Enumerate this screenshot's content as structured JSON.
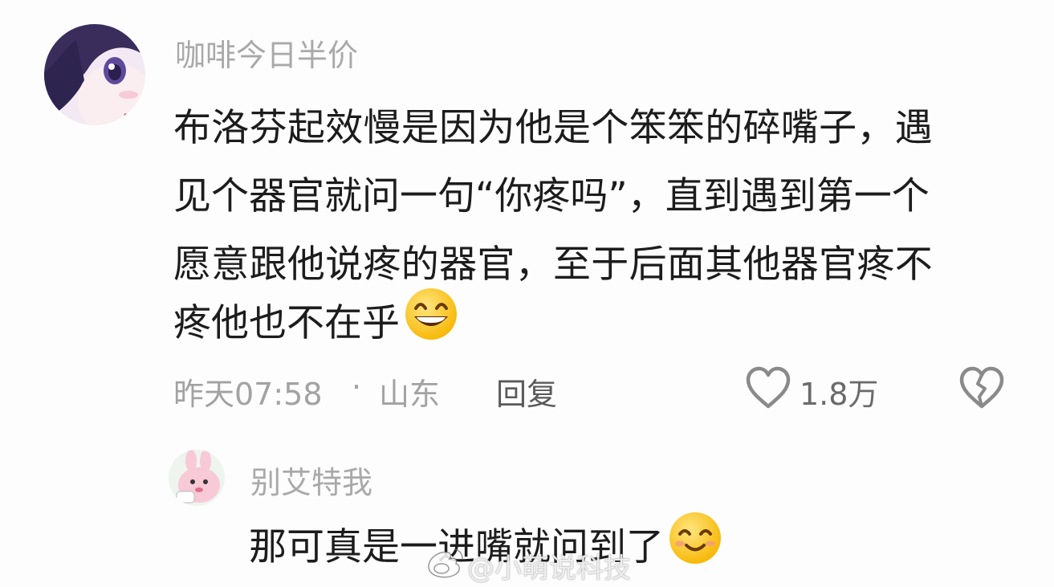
{
  "comment": {
    "username": "咖啡今日半价",
    "lines": [
      "布洛芬起效慢是因为他是个笨笨的碎嘴子，遇",
      "见个器官就问一句“你疼吗”，直到遇到第一个",
      "愿意跟他说疼的器官，至于后面其他器官疼不",
      "疼他也不在乎"
    ],
    "emoji": "grinning-face-emoji",
    "time": "昨天07:58",
    "separator": "·",
    "location": "山东",
    "reply_label": "回复",
    "like_count": "1.8万",
    "like_icon": "heart-outline-icon",
    "dislike_icon": "broken-heart-icon"
  },
  "reply": {
    "username": "别艾特我",
    "text": "那可真是一进嘴就问到了",
    "emoji": "smiling-face-emoji"
  },
  "watermark": {
    "text": "@小萌说科技",
    "icon": "weibo-logo-icon"
  },
  "colors": {
    "username": "#a9a9a9",
    "content": "#1c1c1c",
    "meta": "#a2a2a2",
    "emoji_yellow": "#ffcc33"
  }
}
